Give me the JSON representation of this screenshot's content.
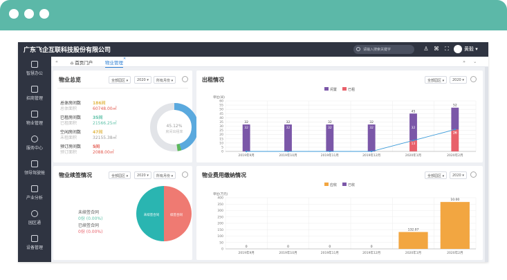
{
  "topbar": {
    "company": "广东飞企互联科技股份有限公司",
    "search_placeholder": "请输入搜索关键字",
    "user_name": "黄毅"
  },
  "sidebar": {
    "items": [
      {
        "label": "智慧办公",
        "icon": "desktop-icon"
      },
      {
        "label": "招商管理",
        "icon": "document-icon"
      },
      {
        "label": "物业管理",
        "icon": "building-icon"
      },
      {
        "label": "服务中心",
        "icon": "service-icon"
      },
      {
        "label": "领导驾驶舱",
        "icon": "dashboard-icon"
      },
      {
        "label": "产业分析",
        "icon": "analysis-icon"
      },
      {
        "label": "园区通",
        "icon": "park-icon"
      },
      {
        "label": "设备管理",
        "icon": "device-icon"
      }
    ]
  },
  "tabs": {
    "home": "首页门户",
    "property": "物业管理"
  },
  "overview": {
    "title": "物业总览",
    "filter_area": "全部园区",
    "filter_year": "2020",
    "filter_month": "所有月份",
    "stats": [
      {
        "label": "总体房间数",
        "value": "186间",
        "sublabel": "总体面积",
        "subvalue": "60748.00㎡",
        "color": "#e2b84a"
      },
      {
        "label": "已租房间数",
        "value": "35间",
        "sublabel": "已租面积",
        "subvalue": "21566.25㎡",
        "color": "#5bc0a6"
      },
      {
        "label": "空闲房间数",
        "value": "47间",
        "sublabel": "未租面积",
        "subvalue": "32155.38㎡",
        "color": "#e2b84a"
      },
      {
        "label": "预订房间数",
        "value": "5间",
        "sublabel": "预订面积",
        "subvalue": "2088.00㎡",
        "color": "#e2574c"
      }
    ],
    "donut_value": "45.12%",
    "donut_label": "房间出租率"
  },
  "contract": {
    "title": "物业续签情况",
    "filter_area": "全部园区",
    "filter_year": "2020",
    "filter_month": "所有月份",
    "unsigned_label": "未续签合同",
    "unsigned_value": "0份  (0.00%)",
    "signed_label": "已续签合同",
    "signed_value": "0份  (0.00%)",
    "pie_left": "未续签合同",
    "pie_right": "续签合同"
  },
  "rental_title": "出租情况",
  "fee_title": "物业费用缴纳情况",
  "rental_filter_area": "全部园区",
  "rental_filter_year": "2020",
  "fee_filter_area": "全部园区",
  "fee_filter_year": "2020",
  "chart_data": [
    {
      "type": "bar",
      "title": "出租情况",
      "ylabel": "单位(间)",
      "categories": [
        "2019年9月",
        "2019年10月",
        "2019年11月",
        "2019年12月",
        "2020年1月",
        "2020年2月"
      ],
      "series": [
        {
          "name": "闲置",
          "values": [
            32,
            32,
            32,
            32,
            32,
            26
          ],
          "color": "#7b57a8"
        },
        {
          "name": "已租",
          "values": [
            0,
            0,
            0,
            0,
            13,
            26
          ],
          "color": "#e8606a"
        }
      ],
      "bar_totals": [
        32,
        32,
        32,
        32,
        45,
        52
      ],
      "ylim": [
        0,
        60
      ],
      "yticks": [
        0,
        5,
        10,
        15,
        20,
        25,
        30,
        35,
        40,
        45,
        50,
        55,
        60
      ],
      "legend": "top-center",
      "grid": true
    },
    {
      "type": "bar",
      "title": "物业费用缴纳情况",
      "ylabel": "单位(万元)",
      "categories": [
        "2019年9月",
        "2019年10月",
        "2019年11月",
        "2019年12月",
        "2020年1月",
        "2020年2月"
      ],
      "series": [
        {
          "name": "应收",
          "values": [
            0,
            0,
            0,
            0,
            132.07,
            366.76
          ],
          "color": "#f2a641"
        },
        {
          "name": "已收",
          "values": [
            0,
            0,
            0,
            0,
            0,
            0
          ],
          "color": "#7b57a8"
        }
      ],
      "value_labels": [
        "0",
        "0",
        "0",
        "0",
        "132.07",
        "10.00"
      ],
      "ylim": [
        0,
        400
      ],
      "yticks": [
        0,
        50,
        100,
        150,
        200,
        250,
        300,
        350,
        400
      ],
      "legend": "top-center",
      "grid": true
    }
  ]
}
